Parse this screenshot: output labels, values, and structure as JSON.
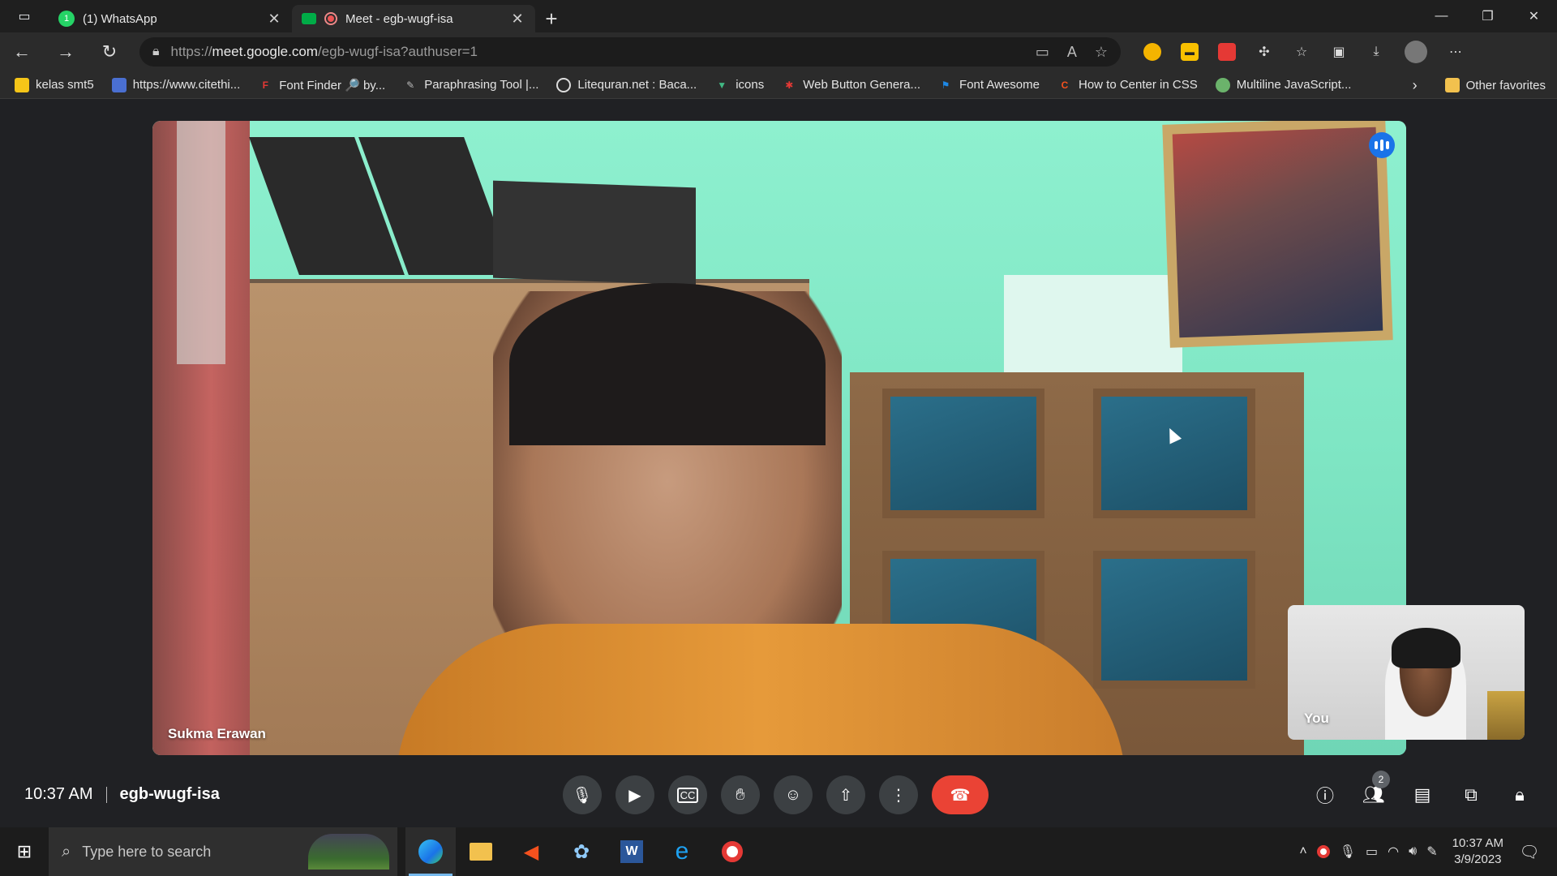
{
  "browser": {
    "tabs": [
      {
        "title": "(1) WhatsApp",
        "close": "✕"
      },
      {
        "title": "Meet - egb-wugf-isa",
        "close": "✕"
      }
    ],
    "url_prefix": "https://",
    "url_host": "meet.google.com",
    "url_path": "/egb-wugf-isa?authuser=1",
    "bookmarks": [
      {
        "label": "kelas smt5",
        "color": "#f5c518"
      },
      {
        "label": "https://www.citethi...",
        "color": "#4a6fd1"
      },
      {
        "label": "Font Finder 🔎 by...",
        "color": "#e53935"
      },
      {
        "label": "Paraphrasing Tool |...",
        "color": "#bbbbbb"
      },
      {
        "label": "Litequran.net : Baca...",
        "color": "#dddddd"
      },
      {
        "label": "icons",
        "color": "#41b883"
      },
      {
        "label": "Web Button Genera...",
        "color": "#e53935"
      },
      {
        "label": "Font Awesome",
        "color": "#1e88e5"
      },
      {
        "label": "How to Center in CSS",
        "color": "#f4511e"
      },
      {
        "label": "Multiline JavaScript...",
        "color": "#6bb36b"
      }
    ],
    "other_favorites": "Other favorites"
  },
  "meet": {
    "main_participant": "Sukma Erawan",
    "self_label": "You",
    "time": "10:37 AM",
    "meeting_code": "egb-wugf-isa",
    "participants_count": "2"
  },
  "taskbar": {
    "search_placeholder": "Type here to search",
    "time": "10:37 AM",
    "date": "3/9/2023"
  }
}
